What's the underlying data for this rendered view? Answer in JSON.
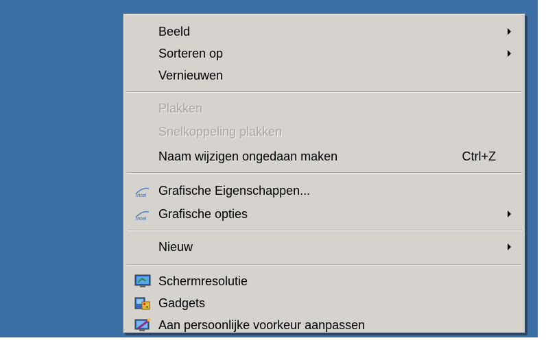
{
  "menu": {
    "items": [
      {
        "label": "Beeld",
        "submenu": true,
        "enabled": true
      },
      {
        "label": "Sorteren op",
        "submenu": true,
        "enabled": true
      },
      {
        "label": "Vernieuwen",
        "submenu": false,
        "enabled": true
      },
      {
        "label": "Plakken",
        "submenu": false,
        "enabled": false
      },
      {
        "label": "Snelkoppeling plakken",
        "submenu": false,
        "enabled": false
      },
      {
        "label": "Naam wijzigen ongedaan maken",
        "shortcut": "Ctrl+Z",
        "submenu": false,
        "enabled": true
      },
      {
        "label": "Grafische Eigenschappen...",
        "icon": "intel-graphics-icon",
        "submenu": false,
        "enabled": true
      },
      {
        "label": "Grafische opties",
        "icon": "intel-graphics-icon",
        "submenu": true,
        "enabled": true
      },
      {
        "label": "Nieuw",
        "submenu": true,
        "enabled": true
      },
      {
        "label": "Schermresolutie",
        "icon": "screen-resolution-icon",
        "submenu": false,
        "enabled": true
      },
      {
        "label": "Gadgets",
        "icon": "gadgets-icon",
        "submenu": false,
        "enabled": true
      },
      {
        "label": "Aan persoonlijke voorkeur aanpassen",
        "icon": "personalize-icon",
        "submenu": false,
        "enabled": true
      }
    ]
  },
  "colors": {
    "desktop": "#3a6ea5",
    "menu_background": "#d6d3ce",
    "disabled_text": "#a7a6a2"
  }
}
